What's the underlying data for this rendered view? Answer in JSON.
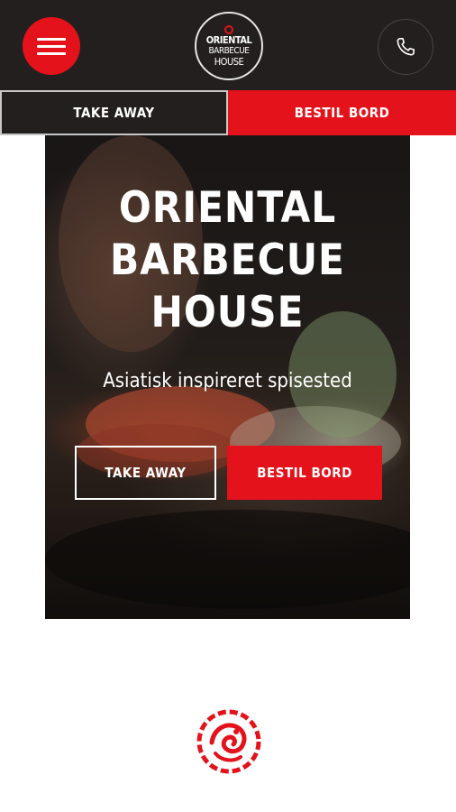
{
  "header": {
    "menu_icon": "hamburger-menu-icon",
    "phone_icon": "phone-icon",
    "logo": {
      "line1": "ORIENTAL",
      "line2": "BARBECUE",
      "line3": "HOUSE"
    }
  },
  "tabs": [
    {
      "label": "TAKE AWAY"
    },
    {
      "label": "BESTIL BORD"
    }
  ],
  "hero": {
    "title_lines": [
      "ORIENTAL",
      "BARBECUE",
      "HOUSE"
    ],
    "subtitle": "Asiatisk inspireret spisested",
    "take_away_label": "TAKE AWAY",
    "bestil_bord_label": "BESTIL BORD"
  },
  "footer": {
    "emblem_icon": "dragon-emblem-icon"
  },
  "colors": {
    "accent": "#e3121b",
    "dark": "#231f1f",
    "white": "#ffffff"
  }
}
